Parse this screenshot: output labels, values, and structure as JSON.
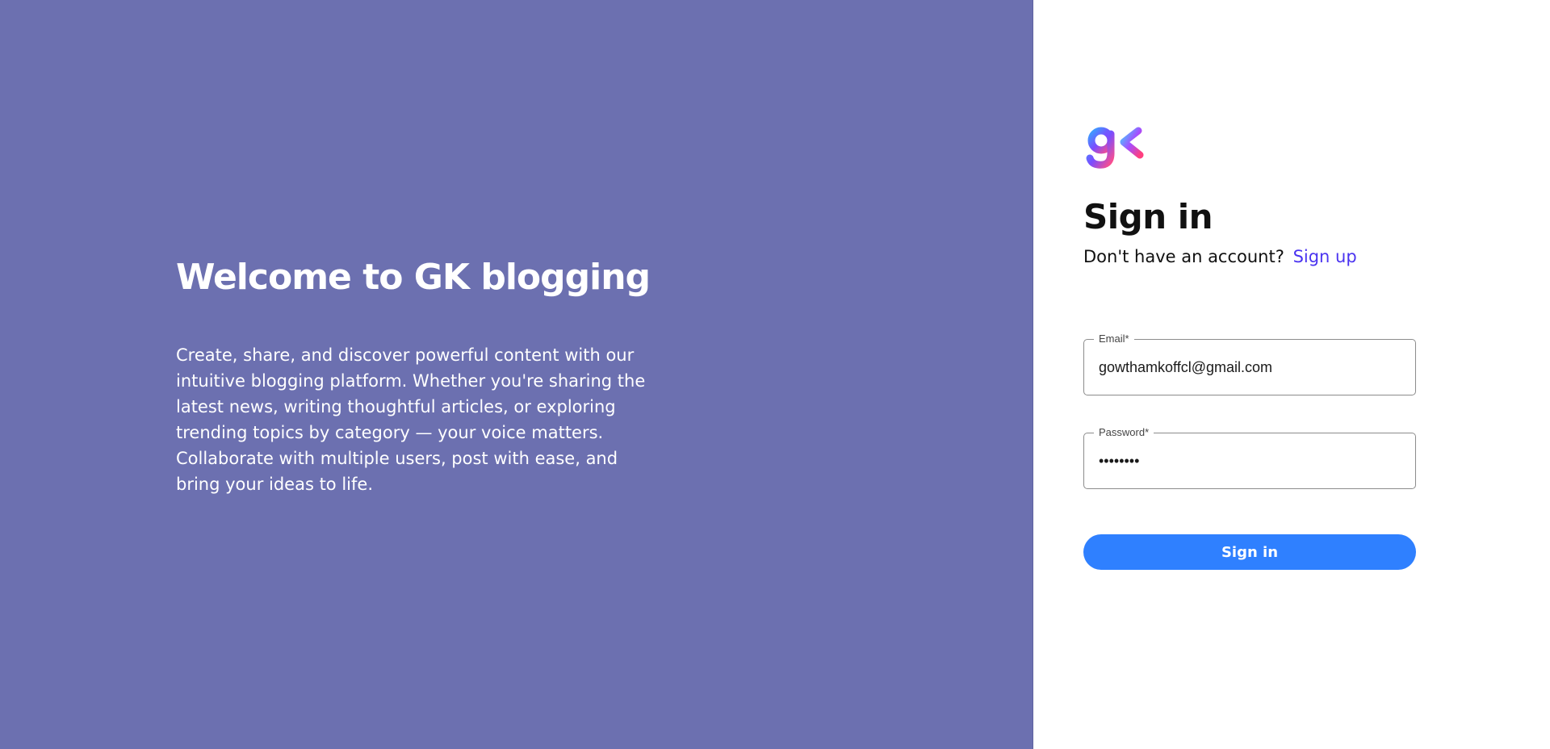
{
  "hero": {
    "title": "Welcome to GK blogging",
    "description": "Create, share, and discover powerful content with our intuitive blogging platform. Whether you're sharing the latest news, writing thoughtful articles, or exploring trending topics by category — your voice matters. Collaborate with multiple users, post with ease, and bring your ideas to life.",
    "background_color": "#6c70b0"
  },
  "auth": {
    "logo_icon": "gk-logo-icon",
    "title": "Sign in",
    "prompt_text": "Don't have an account?",
    "signup_link": "Sign up",
    "email": {
      "label": "Email*",
      "value": "gowthamkoffcl@gmail.com"
    },
    "password": {
      "label": "Password*",
      "value": "••••••••"
    },
    "submit_label": "Sign in",
    "accent_color": "#2f80ff",
    "link_color": "#4b34f0"
  }
}
